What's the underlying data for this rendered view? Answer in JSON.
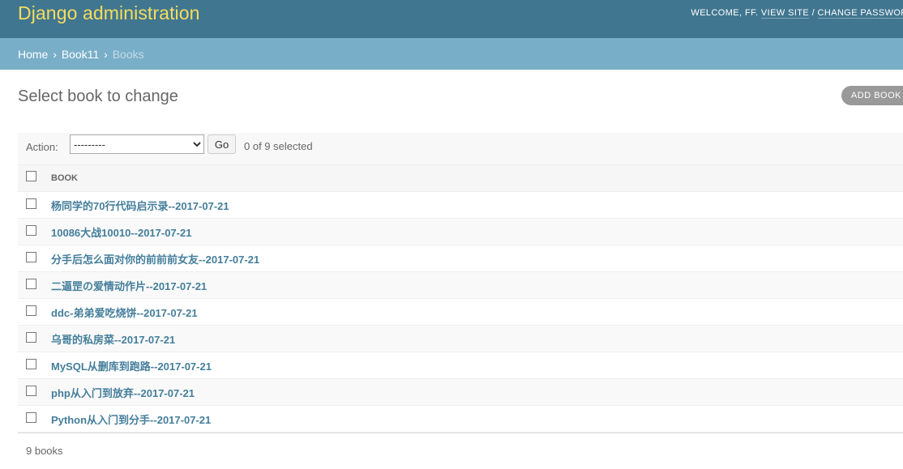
{
  "header": {
    "branding": "Django administration",
    "welcome_prefix": "WELCOME, ",
    "username": "FF",
    "welcome_suffix": ". ",
    "view_site": "VIEW SITE",
    "separator": " / ",
    "change_password": "CHANGE PASSWORD"
  },
  "breadcrumbs": {
    "home": "Home",
    "app": "Book11",
    "current": "Books",
    "sep": "›"
  },
  "content": {
    "title": "Select book to change",
    "add_button": "ADD BOOK"
  },
  "actions": {
    "label": "Action:",
    "selected_option": "---------",
    "go_label": "Go",
    "counter": "0 of 9 selected"
  },
  "table": {
    "column_header": "Book",
    "rows": [
      "杨同学的70行代码启示录--2017-07-21",
      "10086大战10010--2017-07-21",
      "分手后怎么面对你的前前前女友--2017-07-21",
      "二逼罡の爱情动作片--2017-07-21",
      "ddc-弟弟爱吃烧饼--2017-07-21",
      "乌哥的私房菜--2017-07-21",
      "MySQL从删库到跑路--2017-07-21",
      "php从入门到放弃--2017-07-21",
      "Python从入门到分手--2017-07-21"
    ]
  },
  "paginator": {
    "count": "9 books"
  },
  "colors": {
    "header_bg": "#417690",
    "branding": "#f5dd5d",
    "breadcrumbs_bg": "#79aec8",
    "link": "#447e9b"
  }
}
